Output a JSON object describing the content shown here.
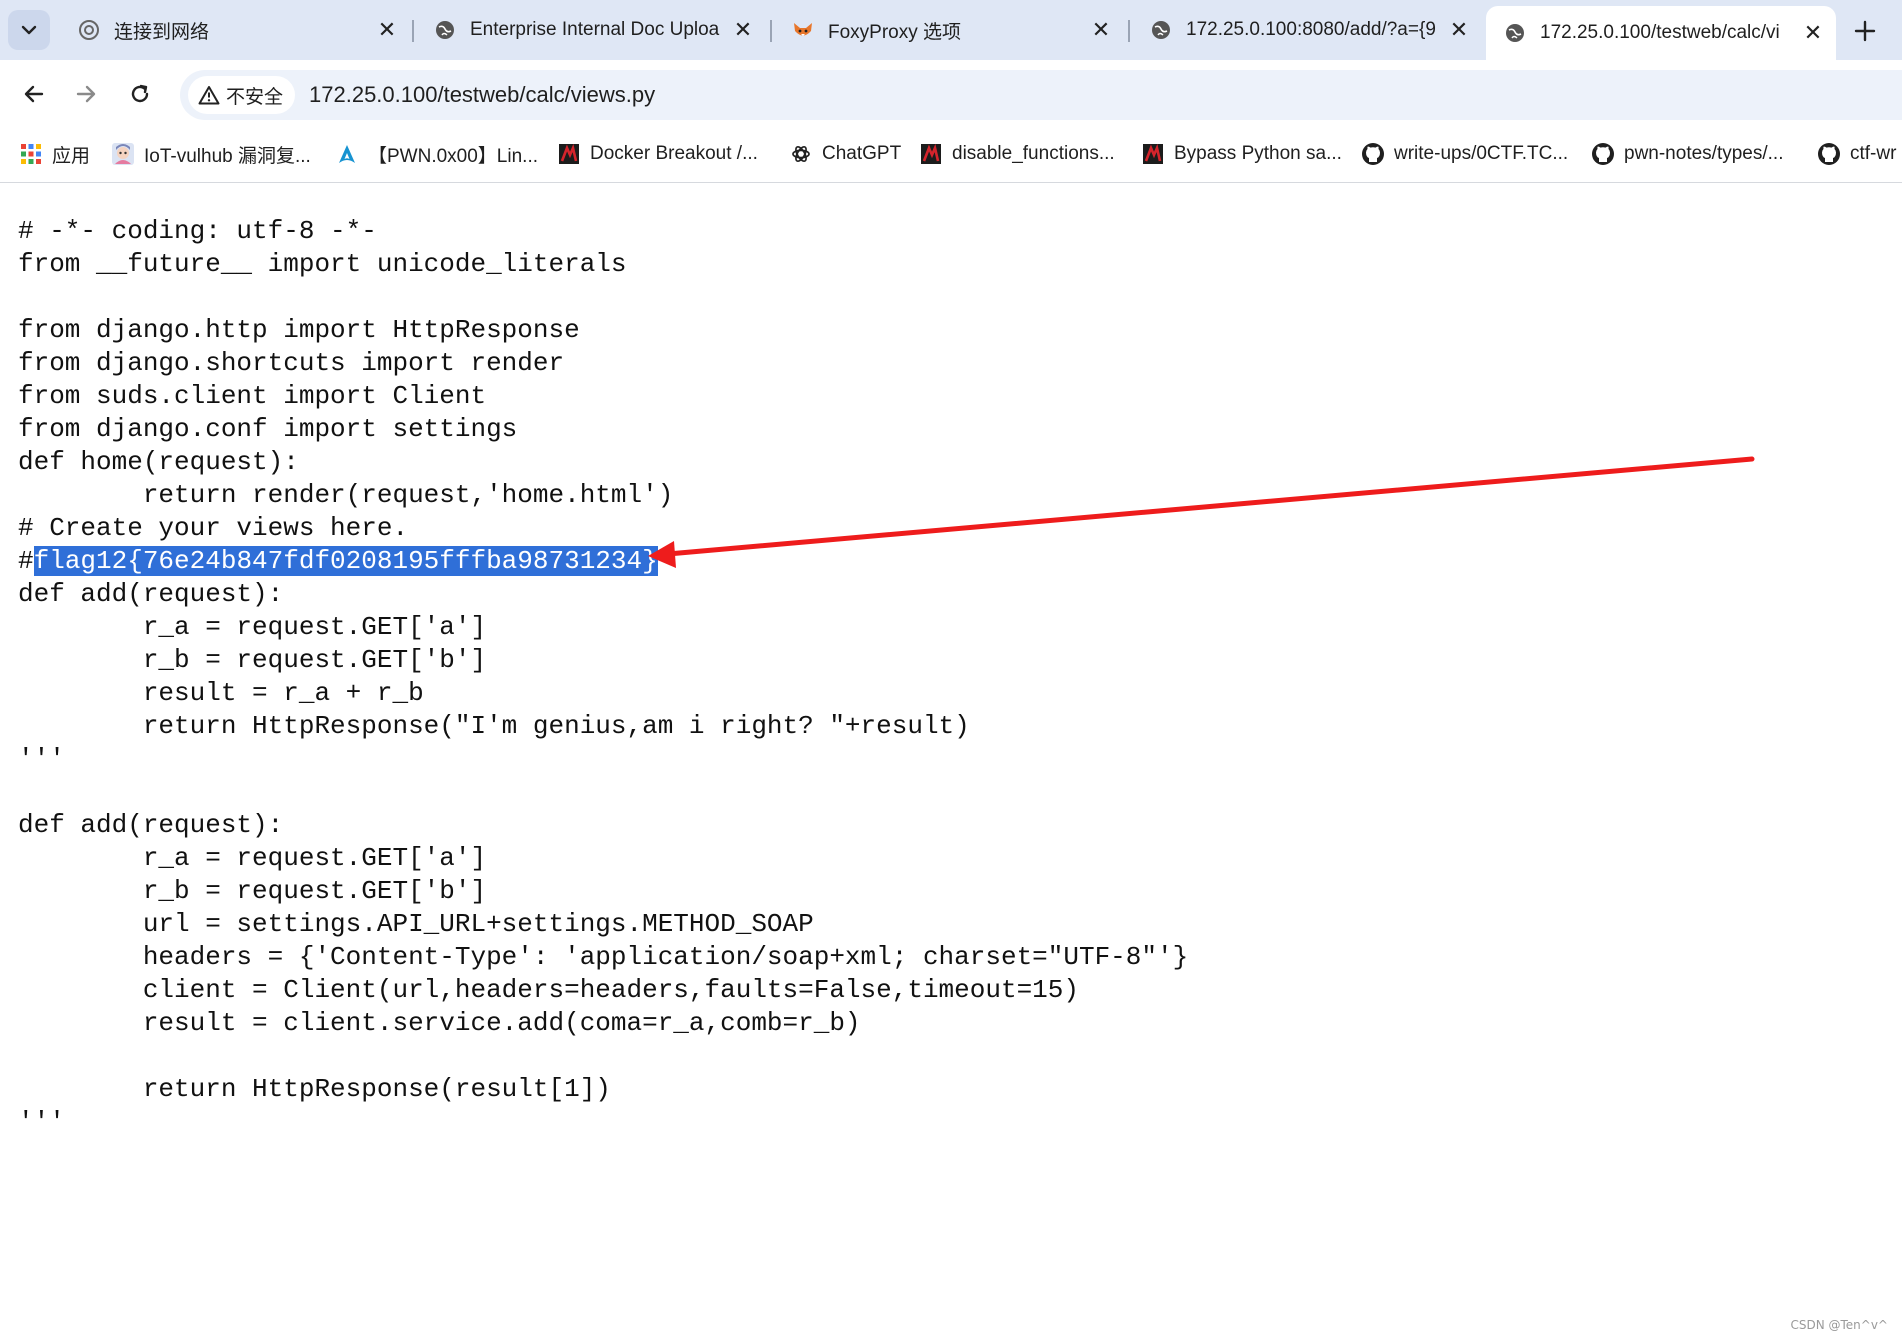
{
  "tabs": [
    {
      "title": "连接到网络",
      "icon": "network-icon",
      "active": false
    },
    {
      "title": "Enterprise Internal Doc Uploa",
      "icon": "globe-icon",
      "active": false
    },
    {
      "title": "FoxyProxy 选项",
      "icon": "foxyproxy-icon",
      "active": false
    },
    {
      "title": "172.25.0.100:8080/add/?a={9",
      "icon": "globe-icon",
      "active": false
    },
    {
      "title": "172.25.0.100/testweb/calc/vi",
      "icon": "globe-icon",
      "active": true
    }
  ],
  "toolbar": {
    "security_label": "不安全",
    "url": "172.25.0.100/testweb/calc/views.py"
  },
  "bookmarks": [
    {
      "label": "应用",
      "icon": "apps-grid-icon"
    },
    {
      "label": "IoT-vulhub 漏洞复...",
      "icon": "anime-avatar-icon"
    },
    {
      "label": "【PWN.0x00】Lin...",
      "icon": "arch-logo-icon"
    },
    {
      "label": "Docker Breakout /...",
      "icon": "hacktricks-icon"
    },
    {
      "label": "ChatGPT",
      "icon": "openai-icon"
    },
    {
      "label": "disable_functions...",
      "icon": "hacktricks-icon"
    },
    {
      "label": "Bypass Python sa...",
      "icon": "hacktricks-icon"
    },
    {
      "label": "write-ups/0CTF.TC...",
      "icon": "github-icon"
    },
    {
      "label": "pwn-notes/types/...",
      "icon": "github-icon"
    },
    {
      "label": "ctf-wr",
      "icon": "github-icon"
    }
  ],
  "code": {
    "lines": [
      "# -*- coding: utf-8 -*-",
      "from __future__ import unicode_literals",
      "",
      "from django.http import HttpResponse",
      "from django.shortcuts import render",
      "from suds.client import Client",
      "from django.conf import settings",
      "def home(request):",
      "        return render(request,'home.html')",
      "# Create your views here.",
      "#flag12{76e24b847fdf0208195fffba98731234}",
      "def add(request):",
      "        r_a = request.GET['a']",
      "        r_b = request.GET['b']",
      "        result = r_a + r_b",
      "        return HttpResponse(\"I'm genius,am i right? \"+result)",
      "'''",
      "",
      "def add(request):",
      "        r_a = request.GET['a']",
      "        r_b = request.GET['b']",
      "        url = settings.API_URL+settings.METHOD_SOAP",
      "        headers = {'Content-Type': 'application/soap+xml; charset=\"UTF-8\"'}",
      "        client = Client(url,headers=headers,faults=False,timeout=15)",
      "        result = client.service.add(coma=r_a,comb=r_b)",
      "",
      "        return HttpResponse(result[1])",
      "'''"
    ],
    "highlight": {
      "line_index": 10,
      "prefix": "#",
      "selected": "flag12{76e24b847fdf0208195fffba98731234}"
    }
  },
  "annotation": {
    "color": "#ee1c1c"
  },
  "watermark": "CSDN @Ten^v^"
}
